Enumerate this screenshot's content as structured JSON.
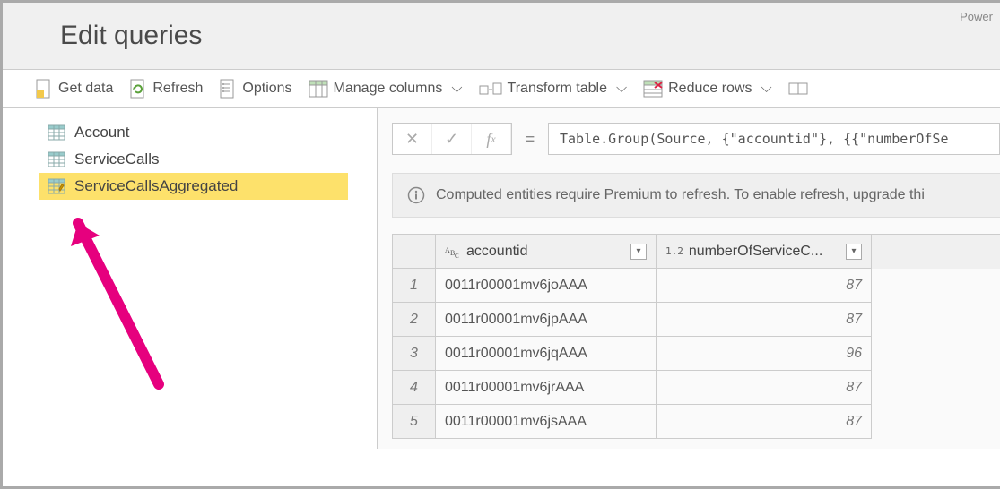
{
  "app_label": "Power",
  "header": {
    "title": "Edit queries"
  },
  "toolbar": {
    "get_data": "Get data",
    "refresh": "Refresh",
    "options": "Options",
    "manage_columns": "Manage columns",
    "transform_table": "Transform table",
    "reduce_rows": "Reduce rows"
  },
  "queries": {
    "items": [
      {
        "label": "Account",
        "selected": false
      },
      {
        "label": "ServiceCalls",
        "selected": false
      },
      {
        "label": "ServiceCallsAggregated",
        "selected": true
      }
    ]
  },
  "formula": {
    "text": "Table.Group(Source, {\"accountid\"}, {{\"numberOfSe"
  },
  "info": {
    "text": "Computed entities require Premium to refresh. To enable refresh, upgrade thi"
  },
  "table": {
    "columns": [
      {
        "type": "ABC",
        "label": "accountid"
      },
      {
        "type": "1.2",
        "label": "numberOfServiceC..."
      }
    ],
    "rows": [
      {
        "n": "1",
        "accountid": "0011r00001mv6joAAA",
        "calls": "87"
      },
      {
        "n": "2",
        "accountid": "0011r00001mv6jpAAA",
        "calls": "87"
      },
      {
        "n": "3",
        "accountid": "0011r00001mv6jqAAA",
        "calls": "96"
      },
      {
        "n": "4",
        "accountid": "0011r00001mv6jrAAA",
        "calls": "87"
      },
      {
        "n": "5",
        "accountid": "0011r00001mv6jsAAA",
        "calls": "87"
      }
    ]
  }
}
